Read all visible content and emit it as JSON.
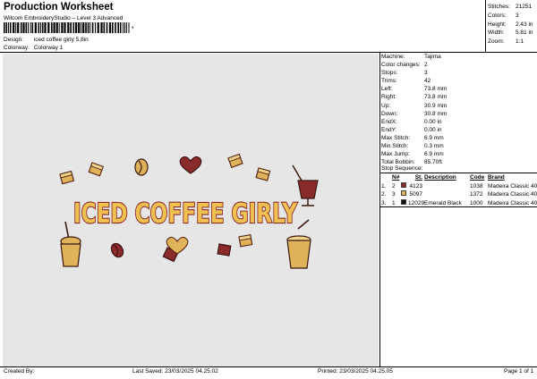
{
  "header": {
    "title": "Production Worksheet",
    "subtitle": "Wilcom EmbroideryStudio – Level 3 Advanced",
    "barcode_suffix": ",",
    "design_label": "Design:",
    "design_value": "iced coffee girly 5,8in",
    "colorway_label": "Colorway:",
    "colorway_value": "Colorway 1"
  },
  "stats": [
    {
      "label": "Stitches:",
      "value": "21251"
    },
    {
      "label": "Colors:",
      "value": "3"
    },
    {
      "label": "Height:",
      "value": "2.43 in"
    },
    {
      "label": "Width:",
      "value": "5.81 in"
    },
    {
      "label": "Zoom:",
      "value": "1:1"
    }
  ],
  "machine_info": [
    {
      "label": "Machine:",
      "value": "Tajima"
    },
    {
      "label": "Color changes:",
      "value": "2"
    },
    {
      "label": "Stops:",
      "value": "3"
    },
    {
      "label": "Trims:",
      "value": "42"
    },
    {
      "label": "Left:",
      "value": "73.8 mm"
    },
    {
      "label": "Right:",
      "value": "73.8 mm"
    },
    {
      "label": "Up:",
      "value": "30.9 mm"
    },
    {
      "label": "Down:",
      "value": "30.8 mm"
    },
    {
      "label": "EndX:",
      "value": "0.00 in"
    },
    {
      "label": "EndY:",
      "value": "0.00 in"
    },
    {
      "label": "Max Stitch:",
      "value": "6.9 mm"
    },
    {
      "label": "Min Stitch:",
      "value": "0.3 mm"
    },
    {
      "label": "Max Jump:",
      "value": "6.9 mm"
    },
    {
      "label": "Total Bobbin:",
      "value": "85.70ft"
    }
  ],
  "stop_sequence": {
    "title": "Stop Sequence:",
    "headers": {
      "n": "N#",
      "st": "St.",
      "desc": "Description",
      "code": "Code",
      "brand": "Brand"
    },
    "rows": [
      {
        "idx": "1.",
        "n": "2",
        "color": "#8b2a2a",
        "st": "4123",
        "desc": "",
        "code": "1038",
        "brand": "Madeira Classic 40"
      },
      {
        "idx": "2.",
        "n": "3",
        "color": "#e0b25a",
        "st": "5097",
        "desc": "",
        "code": "1372",
        "brand": "Madeira Classic 40"
      },
      {
        "idx": "3.",
        "n": "1",
        "color": "#111111",
        "st": "12029",
        "desc": "Emerald Black",
        "code": "1000",
        "brand": "Madeira Classic 40"
      }
    ]
  },
  "design_text": "ICED COFFEE GIRLY",
  "footer": {
    "created_by": "Created By:",
    "last_saved": "Last Saved: 23/03/2025 04.25.02",
    "printed": "Printed: 23/03/2025 04.25.05",
    "page": "Page 1 of 1"
  }
}
